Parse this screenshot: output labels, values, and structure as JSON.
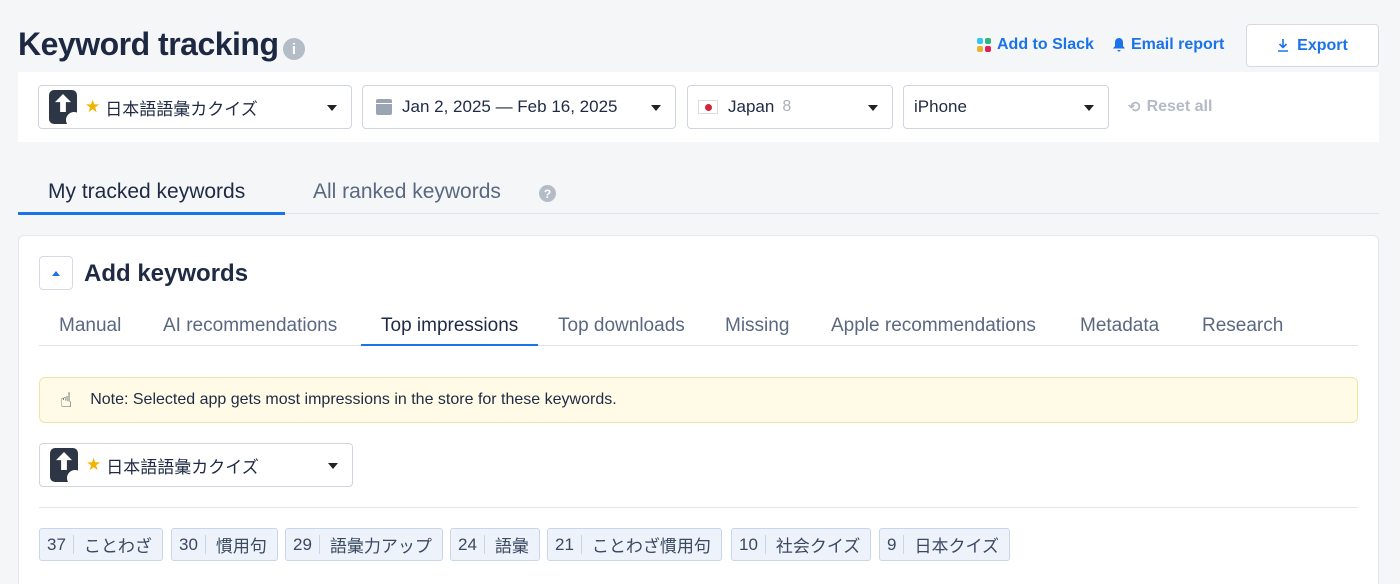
{
  "header": {
    "title": "Keyword tracking",
    "info_icon": "i",
    "add_to_slack": "Add to Slack",
    "email_report": "Email report",
    "export": "Export"
  },
  "filters": {
    "app_name": "日本語語彙カクイズ",
    "date_range": "Jan 2, 2025 — Feb 16, 2025",
    "country": "Japan",
    "country_count": "8",
    "device": "iPhone",
    "reset": "Reset all"
  },
  "main_tabs": [
    {
      "label": "My tracked keywords",
      "active": true
    },
    {
      "label": "All ranked keywords",
      "active": false
    }
  ],
  "help_icon": "?",
  "card": {
    "title": "Add keywords",
    "sub_tabs": [
      {
        "label": "Manual"
      },
      {
        "label": "AI recommendations"
      },
      {
        "label": "Top impressions",
        "active": true
      },
      {
        "label": "Top downloads"
      },
      {
        "label": "Missing"
      },
      {
        "label": "Apple recommendations"
      },
      {
        "label": "Metadata"
      },
      {
        "label": "Research"
      }
    ],
    "note": "Note: Selected app gets most impressions in the store for these keywords.",
    "app_select": "日本語語彙カクイズ",
    "keywords": [
      {
        "num": "37",
        "text": "ことわざ"
      },
      {
        "num": "30",
        "text": "慣用句"
      },
      {
        "num": "29",
        "text": "語彙力アップ"
      },
      {
        "num": "24",
        "text": "語彙"
      },
      {
        "num": "21",
        "text": "ことわざ慣用句"
      },
      {
        "num": "10",
        "text": "社会クイズ"
      },
      {
        "num": "9",
        "text": "日本クイズ"
      }
    ]
  },
  "colors": {
    "accent": "#1a73e8",
    "note_bg": "#fffbe6",
    "star": "#f2b300"
  }
}
